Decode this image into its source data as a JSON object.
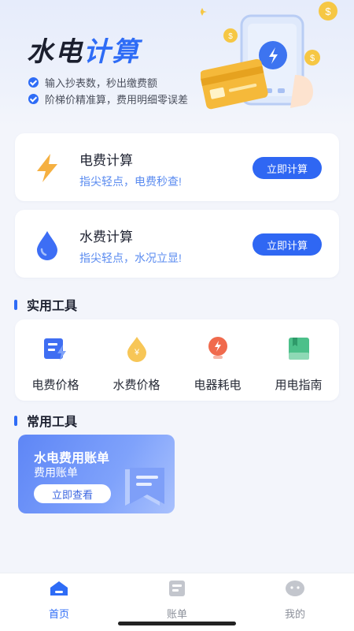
{
  "header": {
    "title_part1": "水电",
    "title_part2": "计算",
    "bullets": [
      "输入抄表数，秒出缴费额",
      "阶梯价精准算，费用明细零误差"
    ]
  },
  "calculators": [
    {
      "title": "电费计算",
      "subtitle": "指尖轻点，电费秒查!",
      "button": "立即计算",
      "icon": "lightning-icon"
    },
    {
      "title": "水费计算",
      "subtitle": "指尖轻点，水况立显!",
      "button": "立即计算",
      "icon": "water-drop-icon"
    }
  ],
  "practical_tools": {
    "heading": "实用工具",
    "items": [
      {
        "label": "电费价格",
        "icon": "electricity-price-icon"
      },
      {
        "label": "水费价格",
        "icon": "water-price-icon"
      },
      {
        "label": "电器耗电",
        "icon": "appliance-bulb-icon"
      },
      {
        "label": "用电指南",
        "icon": "guide-book-icon"
      }
    ]
  },
  "common_tools": {
    "heading": "常用工具",
    "card": {
      "title": "水电费用账单",
      "subtitle": "费用账单",
      "button": "立即查看",
      "icon": "bill-document-icon"
    }
  },
  "tabbar": {
    "tabs": [
      {
        "label": "首页",
        "icon": "home-icon",
        "active": true
      },
      {
        "label": "账单",
        "icon": "bill-icon",
        "active": false
      },
      {
        "label": "我的",
        "icon": "profile-icon",
        "active": false
      }
    ]
  },
  "colors": {
    "accent": "#2e6cf6",
    "background": "#f3f5fb",
    "lightning": "#f5b041",
    "water": "#3d6ef5"
  }
}
